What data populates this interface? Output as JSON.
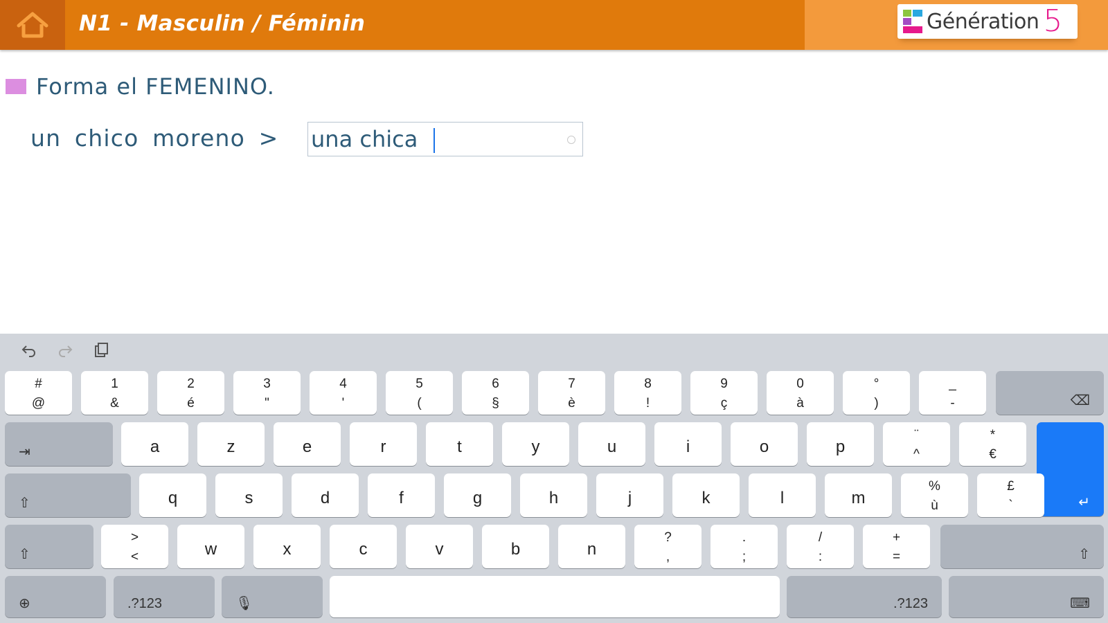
{
  "header": {
    "home_icon": "home-icon",
    "title": "N1 - Masculin / Féminin",
    "brand_name": "Génération",
    "brand_number": "5"
  },
  "exercise": {
    "instruction": "Forma el FEMENINO.",
    "prompt": "un chico moreno >",
    "answer_value": "una chica"
  },
  "keyboard": {
    "toolbar": [
      "undo-icon",
      "redo-icon",
      "clipboard-icon"
    ],
    "row1": [
      {
        "top": "#",
        "bottom": "@"
      },
      {
        "top": "1",
        "bottom": "&"
      },
      {
        "top": "2",
        "bottom": "é"
      },
      {
        "top": "3",
        "bottom": "\""
      },
      {
        "top": "4",
        "bottom": "'"
      },
      {
        "top": "5",
        "bottom": "("
      },
      {
        "top": "6",
        "bottom": "§"
      },
      {
        "top": "7",
        "bottom": "è"
      },
      {
        "top": "8",
        "bottom": "!"
      },
      {
        "top": "9",
        "bottom": "ç"
      },
      {
        "top": "0",
        "bottom": "à"
      },
      {
        "top": "°",
        "bottom": ")"
      },
      {
        "top": "_",
        "bottom": "-"
      }
    ],
    "row2": [
      "a",
      "z",
      "e",
      "r",
      "t",
      "y",
      "u",
      "i",
      "o",
      "p"
    ],
    "row2_extra": [
      {
        "top": "¨",
        "bottom": "^"
      },
      {
        "top": "*",
        "bottom": "€"
      }
    ],
    "row3": [
      "q",
      "s",
      "d",
      "f",
      "g",
      "h",
      "j",
      "k",
      "l",
      "m"
    ],
    "row3_extra": [
      {
        "top": "%",
        "bottom": "ù"
      },
      {
        "top": "£",
        "bottom": "`"
      }
    ],
    "row4_first": {
      "top": ">",
      "bottom": "<"
    },
    "row4": [
      "w",
      "x",
      "c",
      "v",
      "b",
      "n"
    ],
    "row4_extra": [
      {
        "top": "?",
        "bottom": ","
      },
      {
        "top": ".",
        "bottom": ";"
      },
      {
        "top": "/",
        "bottom": ":"
      },
      {
        "top": "+",
        "bottom": "="
      }
    ],
    "numbers_label": ".?123",
    "space_label": ""
  }
}
